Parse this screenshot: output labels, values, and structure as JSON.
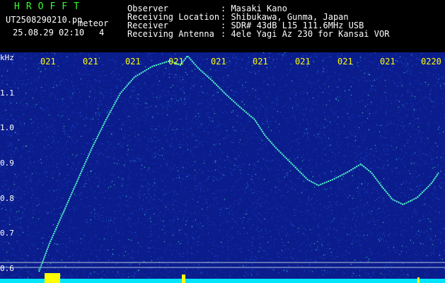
{
  "header": {
    "logo": "HROFFT",
    "filename": "UT2508290210.pn",
    "detection_label": "meteor",
    "datetime": "25.08.29 02:10",
    "count": "4",
    "info_rows": [
      {
        "label": "Observer",
        "value": ": Masaki Kano"
      },
      {
        "label": "Receiving Location",
        "value": ": Shibukawa, Gunma, Japan"
      },
      {
        "label": "Receiver",
        "value": ": SDR# 43dB L15 111.6MHz USB"
      },
      {
        "label": "Receiving Antenna",
        "value": ": 4ele Yagi Az 230 for Kansai VOR"
      }
    ]
  },
  "y_axis": {
    "unit": "kHz",
    "labels": [
      "1.1",
      "1.0",
      "0.9",
      "0.8",
      "0.7",
      "0.6"
    ]
  },
  "x_axis": {
    "labels": [
      "021",
      "021",
      "021",
      "021",
      "021",
      "021",
      "021",
      "021",
      "021",
      "0220"
    ]
  },
  "colors": {
    "background": "#0b1d8c",
    "signal": "#55ffcc",
    "baseline": "#00e5ff",
    "burst": "#ffff00",
    "text_white": "#ffffff",
    "text_yellow": "#ffff00",
    "logo_green": "#33ff33"
  }
}
